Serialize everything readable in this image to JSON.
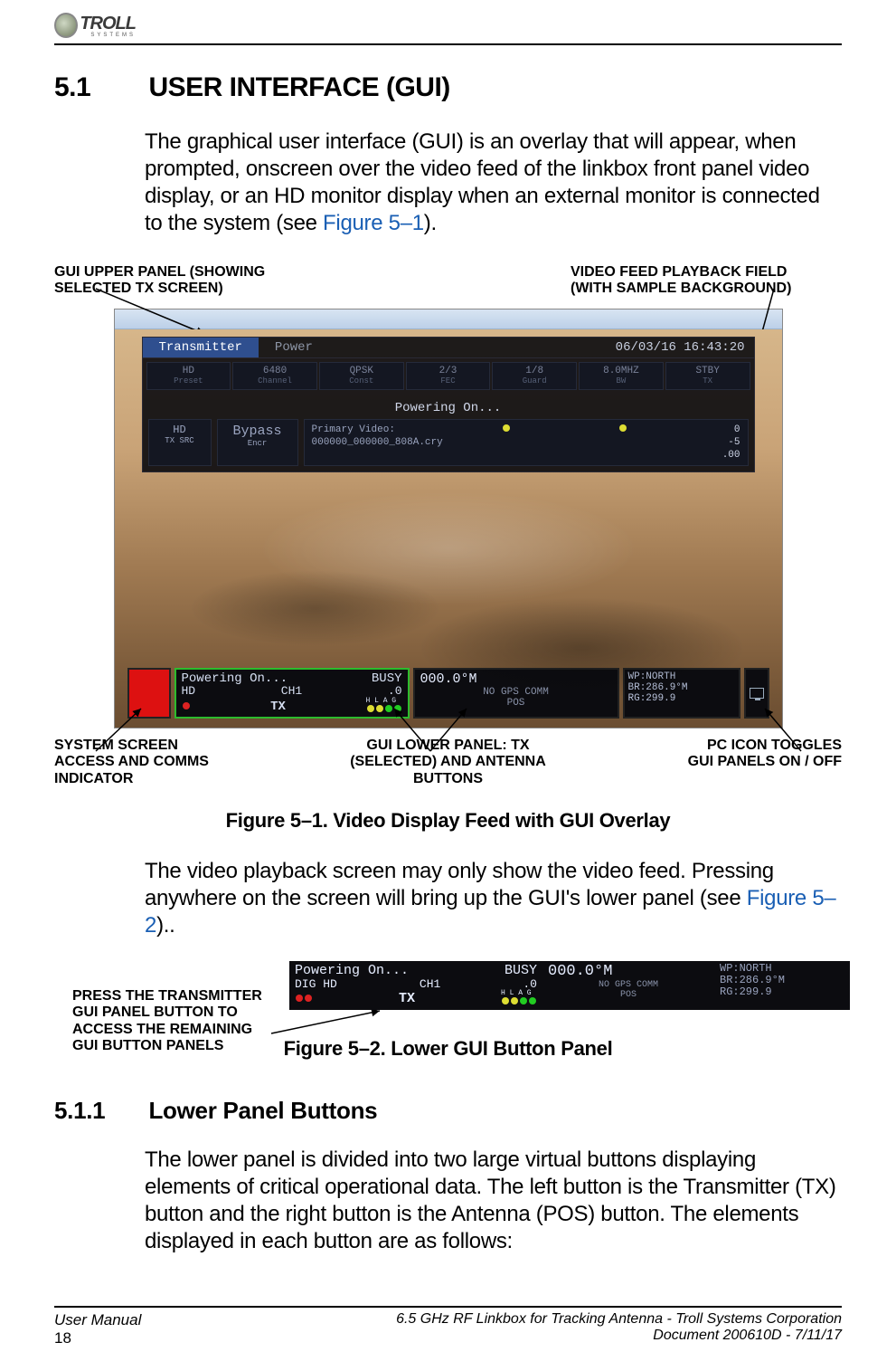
{
  "header": {
    "logo_text": "TROLL",
    "logo_sub": "SYSTEMS"
  },
  "section": {
    "number": "5.1",
    "title": "USER INTERFACE (GUI)",
    "intro_a": "The graphical user interface (GUI) is an overlay that will appear, when prompted, onscreen over the video feed of the linkbox front panel video display, or an HD monitor display when an external monitor is connected to the system (see ",
    "intro_ref": "Figure 5–1",
    "intro_b": ")."
  },
  "callouts_top": {
    "left": "GUI UPPER PANEL (SHOWING SELECTED TX SCREEN)",
    "right": "VIDEO FEED PLAYBACK FIELD (WITH SAMPLE BACKGROUND)"
  },
  "gui_upper": {
    "tab_sel": "Transmitter",
    "tab2": "Power",
    "timestamp": "06/03/16 16:43:20",
    "cells": [
      {
        "t": "HD",
        "s": "Preset"
      },
      {
        "t": "6480",
        "s": "Channel"
      },
      {
        "t": "QPSK",
        "s": "Const"
      },
      {
        "t": "2/3",
        "s": "FEC"
      },
      {
        "t": "1/8",
        "s": "Guard"
      },
      {
        "t": "8.0MHZ",
        "s": "BW"
      },
      {
        "t": "STBY",
        "s": "TX"
      }
    ],
    "status": "Powering On...",
    "lhs": {
      "t": "HD",
      "s": "TX SRC"
    },
    "mhs": {
      "t": "Bypass",
      "s": "Encr"
    },
    "primary_label": "Primary Video:",
    "kv": [
      {
        "k": "",
        "v": "0"
      },
      {
        "k": "",
        "v": "-5"
      },
      {
        "k": "",
        "v": ".00"
      }
    ],
    "crypto": "000000_000000_808A.cry"
  },
  "lower_bar": {
    "tx_line1a": "Powering On...",
    "tx_line1b": "BUSY",
    "tx_line2a": "HD",
    "tx_line2b": "CH1",
    "tx_line2c": ".0",
    "tx_label": "TX",
    "heading": "000.0°M",
    "subhead": "NO GPS COMM",
    "pos_label": "POS",
    "pos1": "WP:NORTH",
    "pos2": "BR:286.9°M",
    "pos3": "RG:299.9",
    "hlag": "H L A G"
  },
  "callouts_bottom": {
    "left": "SYSTEM SCREEN ACCESS AND COMMS INDICATOR",
    "mid": "GUI LOWER PANEL: TX (SELECTED) AND ANTENNA BUTTONS",
    "right": "PC ICON TOGGLES GUI PANELS ON / OFF"
  },
  "fig1_caption": "Figure 5–1.  Video Display Feed with GUI Overlay",
  "para2_a": "The video playback screen may only show the video feed. Pressing anywhere on the screen will bring up the GUI's lower panel (see ",
  "para2_ref": "Figure 5–2",
  "para2_b": ")..",
  "fig2_callout": "PRESS THE TRANSMITTER GUI PANEL BUTTON TO ACCESS THE REMAINING GUI BUTTON PANELS",
  "lower_bar2": {
    "line1a": "Powering On...",
    "line1b": "BUSY",
    "line2a": "DIG HD",
    "line2b": "CH1",
    "line2c": ".0",
    "tx_label": "TX",
    "hlag": "H L A G",
    "heading": "000.0°M",
    "subhead": "NO GPS COMM",
    "pos_label": "POS",
    "pos1": "WP:NORTH",
    "pos2": "BR:286.9°M",
    "pos3": "RG:299.9"
  },
  "fig2_caption": "Figure 5–2.  Lower GUI Button Panel",
  "subsection": {
    "number": "5.1.1",
    "title": "Lower Panel Buttons",
    "body": "The lower panel is divided into two large virtual buttons displaying elements of critical operational data. The left button is the Transmitter (TX) button and the right button is the Antenna (POS) button. The elements displayed in each button are as follows:"
  },
  "footer": {
    "left1": "User Manual",
    "left2": "18",
    "right1": "6.5 GHz RF Linkbox for Tracking Antenna - Troll Systems Corporation",
    "right2": "Document 200610D - 7/11/17"
  }
}
